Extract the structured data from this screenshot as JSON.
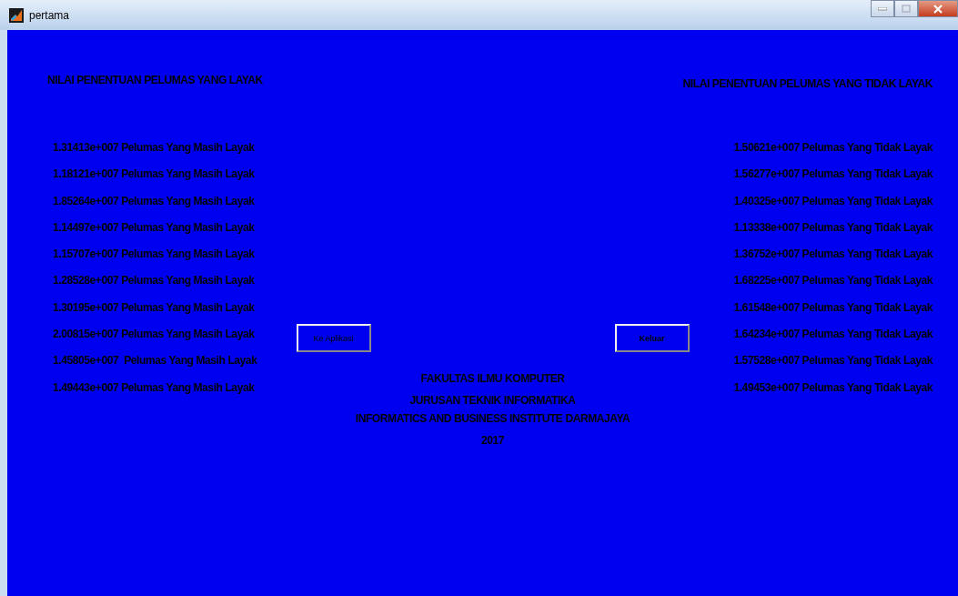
{
  "window": {
    "title": "pertama"
  },
  "left": {
    "heading": "NILAI PENENTUAN PELUMAS YANG LAYAK",
    "items": [
      "1.31413e+007 Pelumas Yang Masih Layak",
      "1.18121e+007 Pelumas Yang Masih Layak",
      "1.85264e+007 Pelumas Yang Masih Layak",
      "1.14497e+007 Pelumas Yang Masih Layak",
      "1.15707e+007 Pelumas Yang Masih Layak",
      "1.28528e+007 Pelumas Yang Masih Layak",
      "1.30195e+007 Pelumas Yang Masih Layak",
      "2.00815e+007 Pelumas Yang Masih Layak",
      "1.45805e+007  Pelumas Yang Masih Layak",
      "1.49443e+007 Pelumas Yang Masih Layak"
    ]
  },
  "right": {
    "heading": "NILAI PENENTUAN PELUMAS YANG TIDAK LAYAK",
    "items": [
      "1.50621e+007 Pelumas Yang Tidak Layak",
      "1.56277e+007 Pelumas Yang Tidak Layak",
      "1.40325e+007 Pelumas Yang Tidak Layak",
      "1.13338e+007 Pelumas Yang Tidak Layak",
      "1.36752e+007 Pelumas Yang Tidak Layak",
      "1.68225e+007 Pelumas Yang Tidak Layak",
      "1.61548e+007 Pelumas Yang Tidak Layak",
      "1.64234e+007 Pelumas Yang Tidak Layak",
      "1.57528e+007 Pelumas Yang Tidak Layak",
      "1.49453e+007 Pelumas Yang Tidak Layak"
    ]
  },
  "buttons": [
    {
      "label": "Ke Aplikasi",
      "bold": false
    },
    {
      "label": "Keluar",
      "bold": true
    }
  ],
  "footer": [
    "FAKULTAS ILMU KOMPUTER",
    "JURUSAN TEKNIK INFORMATIKA",
    "INFORMATICS AND BUSINESS INSTITUTE DARMAJAYA",
    "2017"
  ]
}
